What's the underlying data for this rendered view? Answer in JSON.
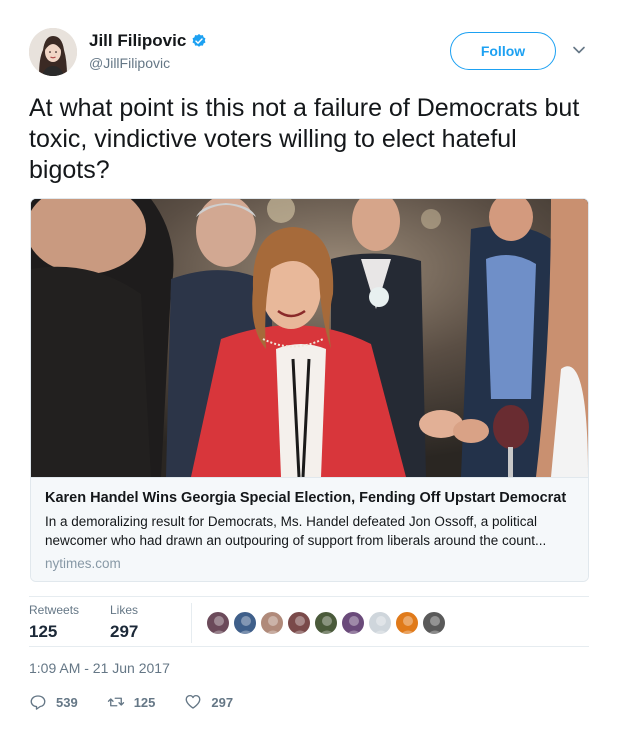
{
  "author": {
    "display_name": "Jill Filipovic",
    "handle": "@JillFilipovic",
    "verified": true,
    "verified_color": "#1da1f2"
  },
  "follow_button": {
    "label": "Follow",
    "color": "#1da1f2"
  },
  "tweet": {
    "text": "At what point is this not a failure of Democrats but toxic, vindictive voters willing to elect hateful bigots?"
  },
  "card": {
    "title": "Karen Handel Wins Georgia Special Election, Fending Off Upstart Democrat",
    "description": "In a demoralizing result for Democrats, Ms. Handel defeated Jon Ossoff, a political newcomer who had drawn an outpouring of support from liberals around the count...",
    "domain": "nytimes.com"
  },
  "stats": {
    "retweets_label": "Retweets",
    "retweets_value": "125",
    "likes_label": "Likes",
    "likes_value": "297"
  },
  "likers": [
    {
      "color": "#6b4a5a"
    },
    {
      "color": "#3f5f8a"
    },
    {
      "color": "#b08a7a"
    },
    {
      "color": "#7a4a4a"
    },
    {
      "color": "#4a5a3a"
    },
    {
      "color": "#6a4a7a"
    },
    {
      "color": "#cfd6dc"
    },
    {
      "color": "#e07a1a"
    },
    {
      "color": "#5a5a5a"
    }
  ],
  "timestamp": "1:09 AM - 21 Jun 2017",
  "actions": {
    "reply_count": "539",
    "retweet_count": "125",
    "like_count": "297"
  },
  "colors": {
    "accent": "#1da1f2",
    "text": "#14171a",
    "secondary": "#657786",
    "card_bg": "#f5f8fa"
  }
}
